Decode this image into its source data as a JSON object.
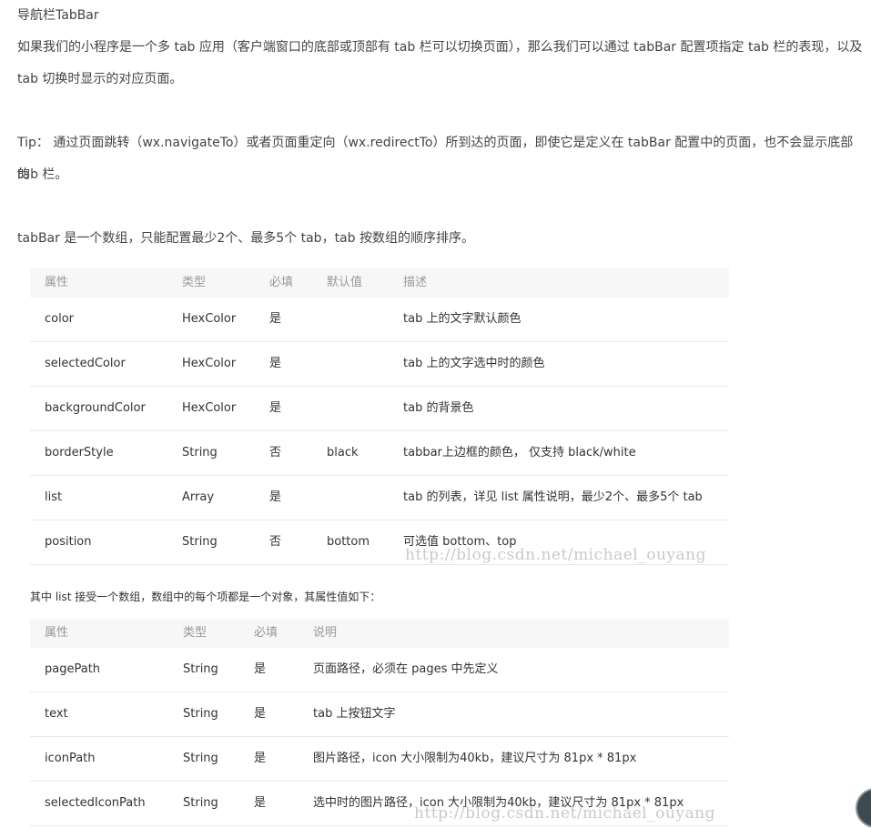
{
  "heading": "导航栏TabBar",
  "intro_line1": "如果我们的小程序是一个多 tab 应用（客户端窗口的底部或顶部有 tab 栏可以切换页面），那么我们可以通过 tabBar 配置项指定 tab 栏的表现，以及",
  "intro_line2": "tab 切换时显示的对应页面。",
  "tip_line1": "Tip： 通过页面跳转（wx.navigateTo）或者页面重定向（wx.redirectTo）所到达的页面，即使它是定义在 tabBar 配置中的页面，也不会显示底部的",
  "tip_line2": "tab 栏。",
  "array_note": "tabBar 是一个数组，只能配置最少2个、最多5个 tab，tab 按数组的顺序排序。",
  "table1": {
    "headers": [
      "属性",
      "类型",
      "必填",
      "默认值",
      "描述"
    ],
    "rows": [
      [
        "color",
        "HexColor",
        "是",
        "",
        "tab 上的文字默认颜色"
      ],
      [
        "selectedColor",
        "HexColor",
        "是",
        "",
        "tab 上的文字选中时的颜色"
      ],
      [
        "backgroundColor",
        "HexColor",
        "是",
        "",
        "tab 的背景色"
      ],
      [
        "borderStyle",
        "String",
        "否",
        "black",
        "tabbar上边框的颜色， 仅支持 black/white"
      ],
      [
        "list",
        "Array",
        "是",
        "",
        "tab 的列表，详见 list 属性说明，最少2个、最多5个 tab"
      ],
      [
        "position",
        "String",
        "否",
        "bottom",
        "可选值 bottom、top"
      ]
    ]
  },
  "list_note": "其中 list 接受一个数组，数组中的每个项都是一个对象，其属性值如下：",
  "table2": {
    "headers": [
      "属性",
      "类型",
      "必填",
      "说明"
    ],
    "rows": [
      [
        "pagePath",
        "String",
        "是",
        "页面路径，必须在 pages 中先定义"
      ],
      [
        "text",
        "String",
        "是",
        "tab 上按钮文字"
      ],
      [
        "iconPath",
        "String",
        "是",
        "图片路径，icon 大小限制为40kb，建议尺寸为 81px * 81px"
      ],
      [
        "selectedIconPath",
        "String",
        "是",
        "选中时的图片路径，icon 大小限制为40kb，建议尺寸为 81px * 81px"
      ]
    ]
  },
  "watermark1": "http://blog.csdn.net/michael_ouyang",
  "watermark2": "http://blog.csdn.net/michael_ouyang",
  "colors": {
    "text": "#444444",
    "header_bg": "#f7f7f7",
    "header_text": "#999999",
    "border": "#e8e8e8"
  }
}
